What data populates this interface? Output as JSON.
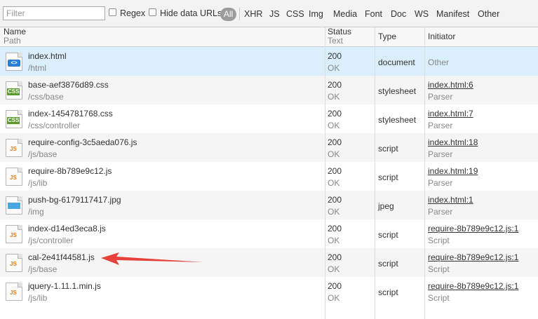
{
  "toolbar": {
    "filter_placeholder": "Filter",
    "regex_label": "Regex",
    "hide_data_urls_label": "Hide data URLs",
    "all_label": "All",
    "types": [
      "XHR",
      "JS",
      "CSS",
      "Img",
      "Media",
      "Font",
      "Doc",
      "WS",
      "Manifest",
      "Other"
    ]
  },
  "header": {
    "name": "Name",
    "path": "Path",
    "status": "Status",
    "text": "Text",
    "type": "Type",
    "initiator": "Initiator"
  },
  "rows": [
    {
      "name": "index.html",
      "path": "/html",
      "status": "200",
      "text": "OK",
      "type": "document",
      "initiator": "",
      "initiator_sub": "Other",
      "icon": "html-file-icon"
    },
    {
      "name": "base-aef3876d89.css",
      "path": "/css/base",
      "status": "200",
      "text": "OK",
      "type": "stylesheet",
      "initiator": "index.html:6",
      "initiator_sub": "Parser",
      "icon": "css-file-icon"
    },
    {
      "name": "index-1454781768.css",
      "path": "/css/controller",
      "status": "200",
      "text": "OK",
      "type": "stylesheet",
      "initiator": "index.html:7",
      "initiator_sub": "Parser",
      "icon": "css-file-icon"
    },
    {
      "name": "require-config-3c5aeda076.js",
      "path": "/js/base",
      "status": "200",
      "text": "OK",
      "type": "script",
      "initiator": "index.html:18",
      "initiator_sub": "Parser",
      "icon": "js-file-icon"
    },
    {
      "name": "require-8b789e9c12.js",
      "path": "/js/lib",
      "status": "200",
      "text": "OK",
      "type": "script",
      "initiator": "index.html:19",
      "initiator_sub": "Parser",
      "icon": "js-file-icon"
    },
    {
      "name": "push-bg-6179117417.jpg",
      "path": "/img",
      "status": "200",
      "text": "OK",
      "type": "jpeg",
      "initiator": "index.html:1",
      "initiator_sub": "Parser",
      "icon": "image-file-icon"
    },
    {
      "name": "index-d14ed3eca8.js",
      "path": "/js/controller",
      "status": "200",
      "text": "OK",
      "type": "script",
      "initiator": "require-8b789e9c12.js:1",
      "initiator_sub": "Script",
      "icon": "js-file-icon"
    },
    {
      "name": "cal-2e41f44581.js",
      "path": "/js/base",
      "status": "200",
      "text": "OK",
      "type": "script",
      "initiator": "require-8b789e9c12.js:1",
      "initiator_sub": "Script",
      "icon": "js-file-icon"
    },
    {
      "name": "jquery-1.11.1.min.js",
      "path": "/js/lib",
      "status": "200",
      "text": "OK",
      "type": "script",
      "initiator": "require-8b789e9c12.js:1",
      "initiator_sub": "Script",
      "icon": "js-file-icon"
    }
  ],
  "colors": {
    "selected_row": "#dbeefb",
    "annotation_arrow": "#e8403a"
  }
}
